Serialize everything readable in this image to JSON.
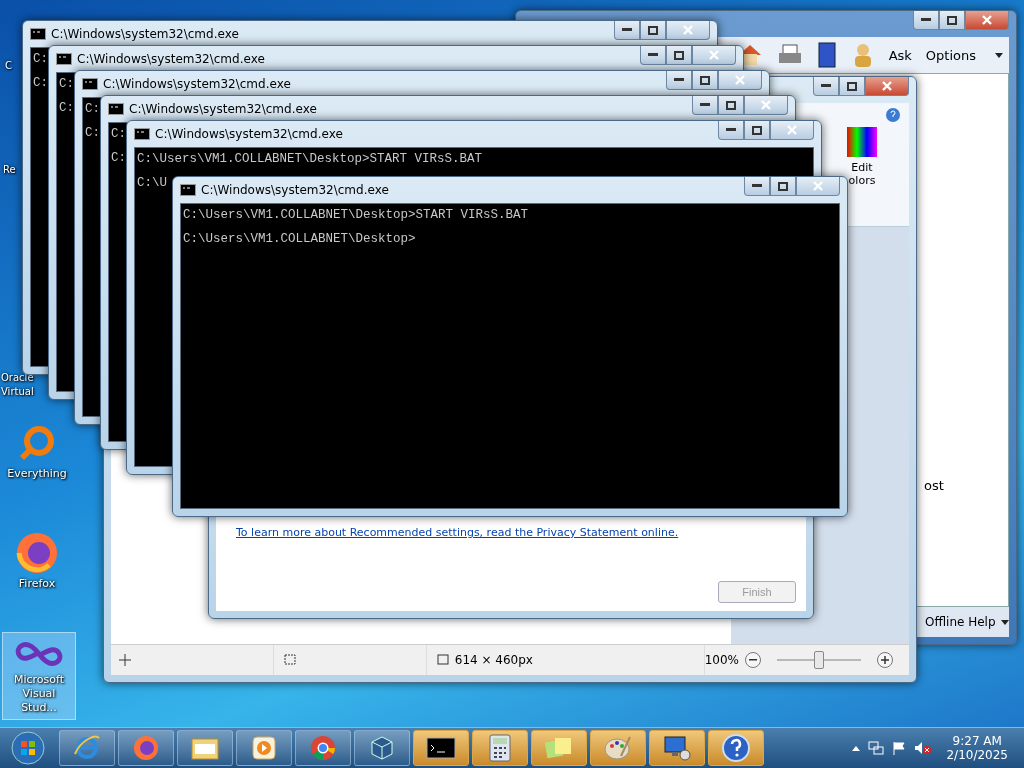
{
  "desktop_icons": [
    {
      "kind": "label_only",
      "label": "C",
      "selected": false
    },
    {
      "kind": "label_only",
      "label": "Re",
      "selected": false
    },
    {
      "kind": "label_only",
      "label": "Oracle Virtual",
      "selected": false
    },
    {
      "kind": "everything",
      "label": "Everything",
      "selected": false
    },
    {
      "kind": "firefox",
      "label": "Firefox",
      "selected": false
    },
    {
      "kind": "visual_studio",
      "label": "Microsoft Visual Stud...",
      "selected": true
    }
  ],
  "help_window": {
    "ask": "Ask",
    "options": "Options",
    "partial_text": "ost",
    "footer": "Offline Help"
  },
  "paint_window": {
    "edit_colors": [
      "Edit",
      "olors"
    ],
    "image_size": "614 × 460px",
    "zoom": "100%",
    "zoom_slider": {
      "level": 0.5
    }
  },
  "dialog": {
    "link": "To learn more about Recommended settings, read the Privacy Statement online.",
    "finish": {
      "label": "Finish",
      "disabled": true
    }
  },
  "cmd_windows": [
    {
      "title": "C:\\Windows\\system32\\cmd.exe",
      "lines": [
        "C:",
        "C:"
      ]
    },
    {
      "title": "C:\\Windows\\system32\\cmd.exe",
      "lines": [
        "C:",
        "C:"
      ]
    },
    {
      "title": "C:\\Windows\\system32\\cmd.exe",
      "lines": [
        "C:",
        "C:"
      ]
    },
    {
      "title": "C:\\Windows\\system32\\cmd.exe",
      "lines": [
        "C:",
        "C:"
      ]
    },
    {
      "title": "C:\\Windows\\system32\\cmd.exe",
      "lines": [
        "C:\\Users\\VM1.COLLABNET\\Desktop>START VIRsS.BAT",
        "C:\\U"
      ]
    },
    {
      "title": "C:\\Windows\\system32\\cmd.exe",
      "lines": [
        "C:\\Users\\VM1.COLLABNET\\Desktop>START VIRsS.BAT",
        "C:\\Users\\VM1.COLLABNET\\Desktop>"
      ]
    }
  ],
  "taskbar": {
    "items": [
      {
        "kind": "ie",
        "running": false
      },
      {
        "kind": "firefox",
        "running": false
      },
      {
        "kind": "explorer",
        "running": false
      },
      {
        "kind": "media",
        "running": false
      },
      {
        "kind": "chrome",
        "running": false
      },
      {
        "kind": "virtualbox",
        "running": false
      },
      {
        "kind": "cmd",
        "running": true
      },
      {
        "kind": "calculator",
        "running": true
      },
      {
        "kind": "notes",
        "running": true
      },
      {
        "kind": "paint",
        "running": true
      },
      {
        "kind": "remote",
        "running": true
      },
      {
        "kind": "help",
        "running": true
      }
    ],
    "time": "9:27 AM",
    "date": "2/10/2025"
  }
}
